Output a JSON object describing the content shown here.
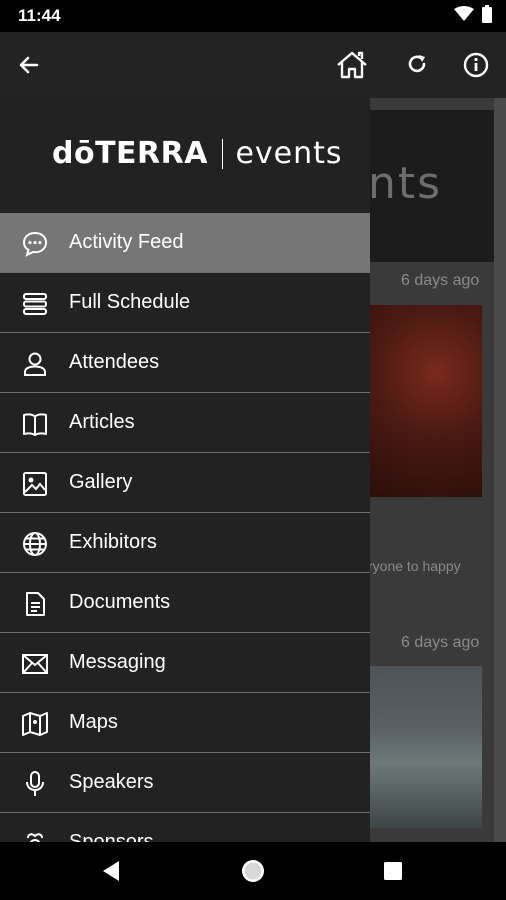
{
  "status": {
    "time": "11:44",
    "icons": [
      "wifi-icon",
      "battery-icon"
    ]
  },
  "app_bar": {
    "icons": [
      "back-arrow-icon",
      "home-icon",
      "refresh-icon",
      "info-icon"
    ]
  },
  "drawer": {
    "logo_brand": "dōTERRA",
    "logo_word": "events",
    "items": [
      {
        "label": "Activity Feed",
        "icon": "chat-bubble-icon",
        "active": true
      },
      {
        "label": "Full Schedule",
        "icon": "stack-icon",
        "active": false
      },
      {
        "label": "Attendees",
        "icon": "person-icon",
        "active": false
      },
      {
        "label": "Articles",
        "icon": "book-icon",
        "active": false
      },
      {
        "label": "Gallery",
        "icon": "image-icon",
        "active": false
      },
      {
        "label": "Exhibitors",
        "icon": "globe-icon",
        "active": false
      },
      {
        "label": "Documents",
        "icon": "document-icon",
        "active": false
      },
      {
        "label": "Messaging",
        "icon": "envelope-icon",
        "active": false
      },
      {
        "label": "Maps",
        "icon": "map-icon",
        "active": false
      },
      {
        "label": "Speakers",
        "icon": "microphone-icon",
        "active": false
      },
      {
        "label": "Sponsors",
        "icon": "sponsor-icon",
        "active": false
      }
    ]
  },
  "feed": {
    "banner_text": "nts",
    "posts": [
      {
        "time": "6 days ago"
      },
      {
        "time": "6 days ago",
        "text": "ryone to happy"
      }
    ]
  },
  "colors": {
    "drawer_bg": "#232222",
    "active_item": "#767676",
    "divider": "#6a6a6a"
  }
}
